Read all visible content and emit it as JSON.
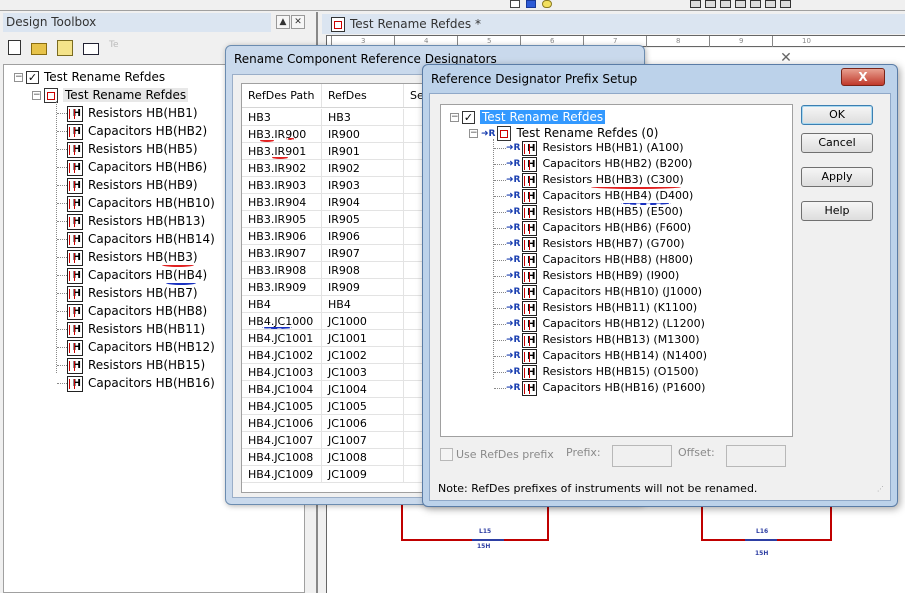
{
  "top_toolbar": {
    "icons": [
      "new-sheet-icon",
      "blue-square-icon",
      "yellow-shape-icon",
      "print-icon",
      "print-preview-icon",
      "zoom-icon",
      "grid-icon",
      "window-icon",
      "layout-icon",
      "panel-icon"
    ]
  },
  "toolbox": {
    "title": "Design Toolbox",
    "minimize_label": "▲",
    "close_label": "✕",
    "toolbar_icons": [
      "new-design-icon",
      "open-folder-icon",
      "save-icon",
      "export-icon",
      "text-icon"
    ],
    "text_icon_label": "Te",
    "tree": {
      "root_label": "Test Rename Refdes",
      "child_label": "Test Rename Refdes",
      "items": [
        "Resistors HB(HB1)",
        "Capacitors HB(HB2)",
        "Resistors HB(HB5)",
        "Capacitors HB(HB6)",
        "Resistors HB(HB9)",
        "Capacitors HB(HB10)",
        "Resistors HB(HB13)",
        "Capacitors HB(HB14)",
        "Resistors HB(HB3)",
        "Capacitors HB(HB4)",
        "Resistors HB(HB7)",
        "Capacitors HB(HB8)",
        "Resistors HB(HB11)",
        "Capacitors HB(HB12)",
        "Resistors HB(HB15)",
        "Capacitors HB(HB16)"
      ]
    }
  },
  "schematic": {
    "tab_title": "Test Rename Refdes *",
    "ruler_ticks": [
      "3",
      "4",
      "5",
      "6",
      "7",
      "8",
      "9",
      "10"
    ],
    "components": [
      {
        "ref": "L15",
        "value": "15H"
      },
      {
        "ref": "L16",
        "value": "15H"
      }
    ]
  },
  "rename_dialog": {
    "title": "Rename Component Reference Designators",
    "close_label": "✕",
    "columns": [
      "RefDes Path",
      "RefDes",
      "Sec"
    ],
    "rows": [
      [
        "HB3",
        "HB3"
      ],
      [
        "HB3.IR900",
        "IR900"
      ],
      [
        "HB3.IR901",
        "IR901"
      ],
      [
        "HB3.IR902",
        "IR902"
      ],
      [
        "HB3.IR903",
        "IR903"
      ],
      [
        "HB3.IR904",
        "IR904"
      ],
      [
        "HB3.IR905",
        "IR905"
      ],
      [
        "HB3.IR906",
        "IR906"
      ],
      [
        "HB3.IR907",
        "IR907"
      ],
      [
        "HB3.IR908",
        "IR908"
      ],
      [
        "HB3.IR909",
        "IR909"
      ],
      [
        "HB4",
        "HB4"
      ],
      [
        "HB4.JC1000",
        "JC1000"
      ],
      [
        "HB4.JC1001",
        "JC1001"
      ],
      [
        "HB4.JC1002",
        "JC1002"
      ],
      [
        "HB4.JC1003",
        "JC1003"
      ],
      [
        "HB4.JC1004",
        "JC1004"
      ],
      [
        "HB4.JC1005",
        "JC1005"
      ],
      [
        "HB4.JC1006",
        "JC1006"
      ],
      [
        "HB4.JC1007",
        "JC1007"
      ],
      [
        "HB4.JC1008",
        "JC1008"
      ],
      [
        "HB4.JC1009",
        "JC1009"
      ]
    ]
  },
  "prefix_dialog": {
    "title": "Reference Designator Prefix Setup",
    "close_label": "X",
    "tree": {
      "root_label": "Test Rename Refdes",
      "child_label": "Test Rename Refdes (0)",
      "items": [
        "Resistors HB(HB1) (A100)",
        "Capacitors HB(HB2) (B200)",
        "Resistors HB(HB3) (C300)",
        "Capacitors HB(HB4) (D400)",
        "Resistors HB(HB5) (E500)",
        "Capacitors HB(HB6) (F600)",
        "Resistors HB(HB7) (G700)",
        "Capacitors HB(HB8) (H800)",
        "Resistors HB(HB9) (I900)",
        "Capacitors HB(HB10) (J1000)",
        "Resistors HB(HB11) (K1100)",
        "Capacitors HB(HB12) (L1200)",
        "Resistors HB(HB13) (M1300)",
        "Capacitors HB(HB14) (N1400)",
        "Resistors HB(HB15) (O1500)",
        "Capacitors HB(HB16) (P1600)"
      ]
    },
    "buttons": {
      "ok": "OK",
      "cancel": "Cancel",
      "apply": "Apply",
      "help": "Help"
    },
    "use_prefix_label": "Use RefDes prefix",
    "use_prefix_checked": false,
    "prefix_label": "Prefix:",
    "prefix_value": "",
    "offset_label": "Offset:",
    "offset_value": "",
    "note": "Note: RefDes prefixes of instruments will not be renamed."
  },
  "colors": {
    "selection": "#3399ff",
    "annotation_red": "#e02020",
    "annotation_blue": "#1830c0",
    "wire": "#c00000"
  }
}
